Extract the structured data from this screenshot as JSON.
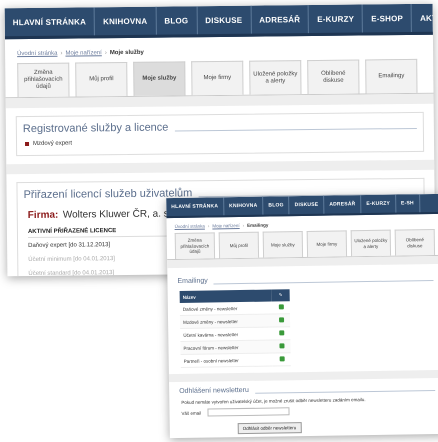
{
  "nav": [
    "HLAVNÍ STRÁNKA",
    "KNIHOVNA",
    "BLOG",
    "DISKUSE",
    "ADRESÁŘ",
    "E-KURZY",
    "E-SHOP",
    "AKTUÁLNÍ AKCE"
  ],
  "nav_b": [
    "HLAVNÍ STRÁNKA",
    "KNIHOVNA",
    "BLOG",
    "DISKUSE",
    "ADRESÁŘ",
    "E-KURZY",
    "E-SH"
  ],
  "breadcrumb": {
    "home": "Úvodní stránka",
    "section": "Moje nařízení",
    "current": "Moje služby"
  },
  "breadcrumb_b": {
    "home": "Úvodní stránka",
    "section": "Moje nařízení",
    "current": "Emailingy"
  },
  "tabs": [
    "Změna přihlašovacích údajů",
    "Můj profil",
    "Moje služby",
    "Moje firmy",
    "Uložené položky a alerty",
    "Oblíbené diskuse",
    "Emailingy"
  ],
  "tabs_b": [
    "Změna přihlašovacích údajů",
    "Můj profil",
    "Moje služby",
    "Moje firmy",
    "Uložené položky a alerty",
    "Oblíbené diskuse"
  ],
  "services": {
    "title": "Registrované služby a licence",
    "items": [
      "Mzdový expert"
    ]
  },
  "assign": {
    "title": "Přiřazení licencí služeb uživatelům",
    "firm_label": "Firma:",
    "firm_name": "Wolters Kluwer ČR, a. s.",
    "active_header": "AKTIVNÍ PŘIŘAZENÉ LICENCE",
    "rows": [
      {
        "text": "Daňový expert [do 31.12.2013]",
        "muted": false
      },
      {
        "text": "Účetní minimum [do 04.01.2013]",
        "muted": true
      },
      {
        "text": "Účetní standard [do 04.01.2013]",
        "muted": true
      }
    ]
  },
  "emailing": {
    "title": "Emailingy",
    "col_name": "Název",
    "rows": [
      "Daňové změny - newsletter",
      "Mzdové změny - newsletter",
      "Účetní kavárna - newsletter",
      "Pracovní fórum - newsletter",
      "Partneři - osobní newsletter"
    ]
  },
  "newsletter": {
    "title": "Odhlášení newsletteru",
    "text": "Pokud nemáte vytvořen uživatelský účet, je možné zrušit odběr newsletteru zadáním emailu.",
    "email_label": "Váš email",
    "button": "Odhlásit odběr newsletteru"
  }
}
